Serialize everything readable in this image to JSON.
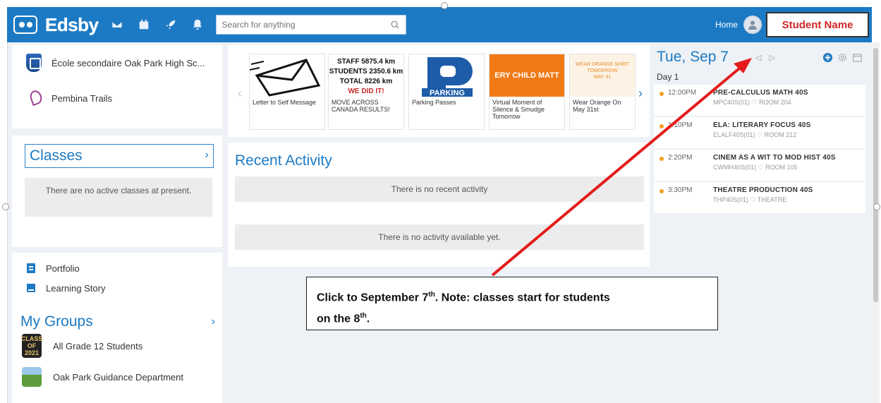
{
  "header": {
    "brand": "Edsby",
    "search_placeholder": "Search for anything",
    "home_label": "Home",
    "student_name": "Student Name",
    "icons": [
      "mail-icon",
      "calendar-icon",
      "rocket-icon",
      "bell-icon",
      "search-icon",
      "user-avatar-icon"
    ],
    "colors": {
      "bar": "#1c7ac4",
      "student_name_text": "#d12525"
    }
  },
  "schools": [
    {
      "name": "École secondaire Oak Park High Sc..."
    },
    {
      "name": "Pembina Trails"
    }
  ],
  "classes": {
    "title": "Classes",
    "empty_text": "There are no active classes at present."
  },
  "links": [
    {
      "label": "Portfolio",
      "icon": "portfolio-icon"
    },
    {
      "label": "Learning Story",
      "icon": "learning-story-icon"
    }
  ],
  "groups": {
    "title": "My Groups",
    "items": [
      {
        "label": "All Grade 12 Students",
        "badge_lines": [
          "CLASS",
          "OF",
          "2021"
        ]
      },
      {
        "label": "Oak Park Guidance Department"
      }
    ]
  },
  "carousel": {
    "tiles": [
      {
        "caption": "Letter to Self Message"
      },
      {
        "caption": "MOVE ACROSS CANADA RESULTS!",
        "img_lines": [
          "STAFF 5875.4 km",
          "STUDENTS 2350.6 km",
          "TOTAL 8226 km",
          "WE DID IT!"
        ]
      },
      {
        "caption": "Parking Passes",
        "img_text": "PARKING"
      },
      {
        "caption": "Virtual Moment of Silence & Smudge Tomorrow",
        "img_text": "ERY CHILD MATT"
      },
      {
        "caption": "Wear Orange On May 31st",
        "img_lines": [
          "WEAR ORANGE SHIRT",
          "TOMORROW",
          "MAY 31"
        ]
      }
    ]
  },
  "activity": {
    "title": "Recent Activity",
    "empty_recent": "There is no recent activity",
    "empty_available": "There is no activity available yet."
  },
  "agenda": {
    "date": "Tue, Sep 7",
    "day": "Day 1",
    "nav": "◁ ▷",
    "events": [
      {
        "time": "12:00PM",
        "title": "PRE-CALCULUS MATH 40S",
        "sub": "MPC40S(01) ♡ ROOM 204"
      },
      {
        "time": "1:10PM",
        "title": "ELA: LITERARY FOCUS 40S",
        "sub": "ELALF40S(01) ♡ ROOM 212"
      },
      {
        "time": "2:20PM",
        "title": "CINEM AS A WIT TO MOD HIST 40S",
        "sub": "CWMH40S(01) ♡ ROOM 105"
      },
      {
        "time": "3:30PM",
        "title": "THEATRE PRODUCTION 40S",
        "sub": "THP40S(01) ♡ THEATRE"
      }
    ]
  },
  "annotation": {
    "line1_pre": "Click to September 7",
    "line1_sup": "th",
    "line1_post": ". Note: classes start for students",
    "line2_pre": "on the 8",
    "line2_sup": "th",
    "line2_post": ".",
    "arrow_color": "#e31b1b"
  }
}
